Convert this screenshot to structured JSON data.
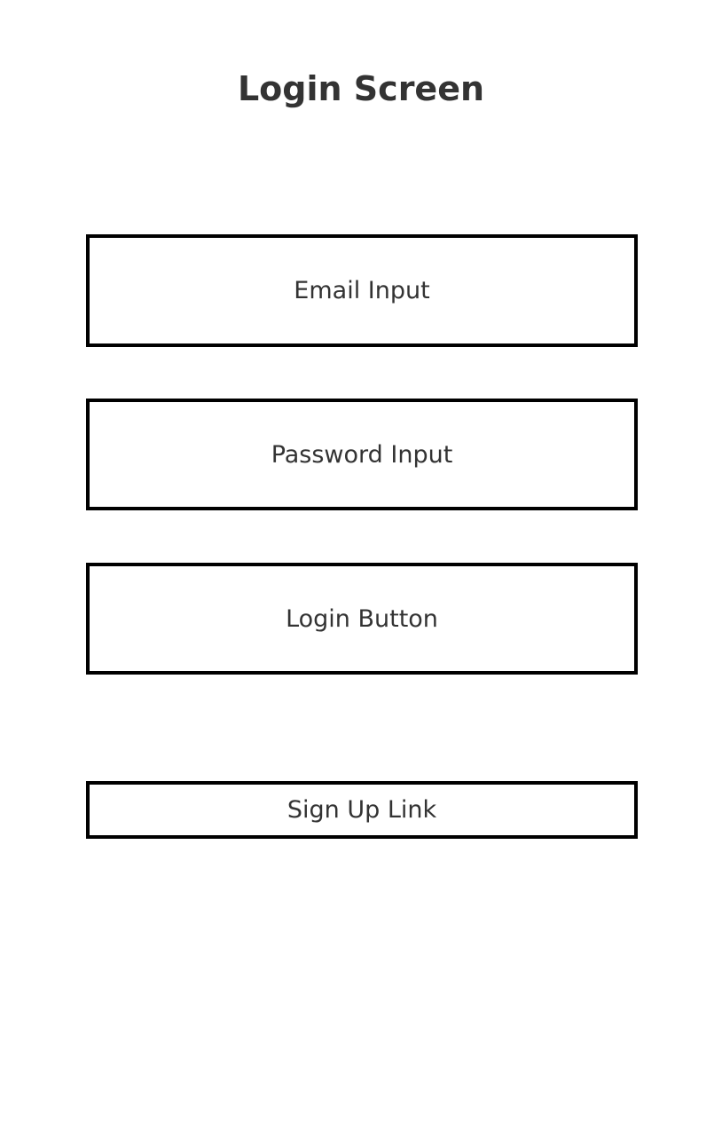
{
  "header": {
    "title": "Login Screen"
  },
  "form": {
    "email_label": "Email Input",
    "password_label": "Password Input",
    "login_label": "Login Button",
    "signup_label": "Sign Up Link"
  }
}
